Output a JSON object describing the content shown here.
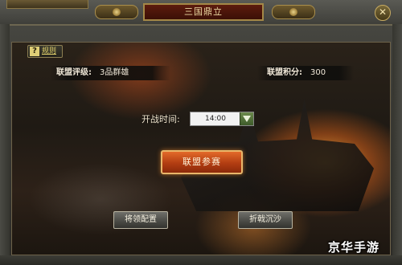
{
  "window": {
    "top_left_tab": "",
    "title": "三国鼎立",
    "close_label": "✕"
  },
  "help": {
    "icon_label": "?",
    "link_text": "规则"
  },
  "alliance": {
    "rating_label": "联盟评级:",
    "rating_value": "3品群雄",
    "score_label": "联盟积分:",
    "score_value": "300"
  },
  "battle": {
    "time_label": "开战时间:",
    "time_value": "14:00"
  },
  "buttons": {
    "join": "联盟参赛",
    "general_config": "将领配置",
    "return": "折戟沉沙"
  },
  "watermark": "京华手游",
  "colors": {
    "title_bg": "#5d1c0e",
    "join_button": "#e36a2a",
    "gold_border": "#a48847",
    "help_link": "#e4d36d"
  },
  "icons": {
    "close": "close-icon",
    "help": "question-icon",
    "dropdown": "chevron-down-icon"
  }
}
